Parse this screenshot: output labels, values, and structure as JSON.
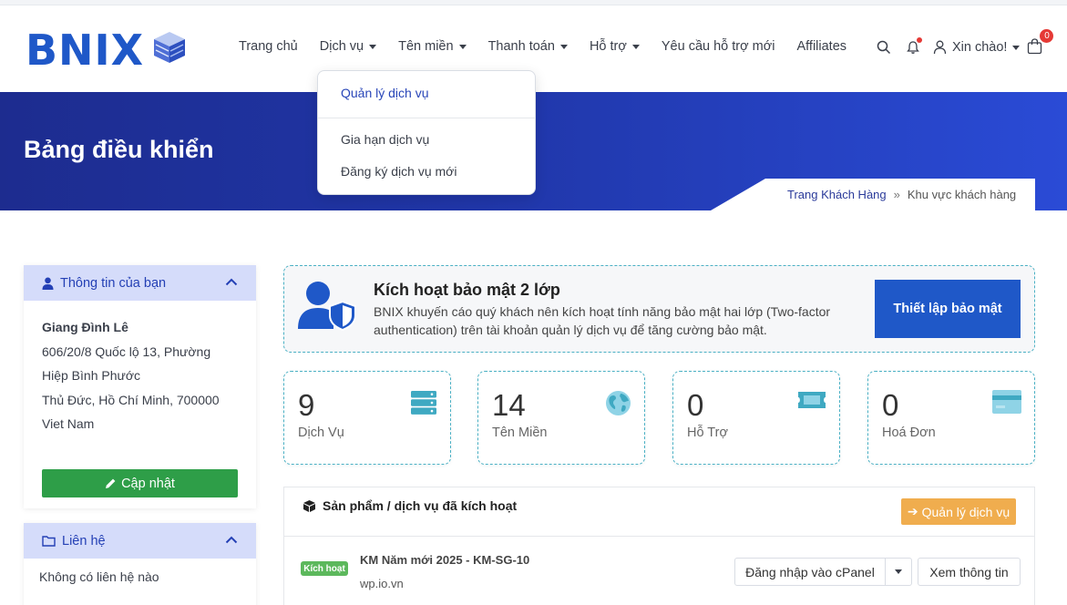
{
  "brand": {
    "logo_text": "BNIX",
    "accent": "#1f58c8"
  },
  "nav": {
    "items": [
      {
        "label": "Trang chủ",
        "caret": false
      },
      {
        "label": "Dịch vụ",
        "caret": true
      },
      {
        "label": "Tên miền",
        "caret": true
      },
      {
        "label": "Thanh toán",
        "caret": true
      },
      {
        "label": "Hỗ trợ",
        "caret": true
      },
      {
        "label": "Yêu cầu hỗ trợ mới",
        "caret": false
      },
      {
        "label": "Affiliates",
        "caret": false
      }
    ],
    "greeting": "Xin chào!",
    "cart_count": "0"
  },
  "dropdown": {
    "items": [
      "Quản lý dịch vụ",
      "Gia hạn dịch vụ",
      "Đăng ký dịch vụ mới"
    ]
  },
  "banner": {
    "title": "Bảng điều khiển",
    "breadcrumb_link": "Trang Khách Hàng",
    "breadcrumb_sep": "»",
    "breadcrumb_current": "Khu vực khách hàng"
  },
  "sidebar": {
    "info": {
      "title": "Thông tin của bạn",
      "name": "Giang Đình Lê",
      "address_lines": [
        "606/20/8 Quốc lộ 13, Phường",
        "Hiệp Bình Phước",
        "Thủ Đức, Hồ Chí Minh, 700000",
        "Viet Nam"
      ],
      "update_label": "Cập nhật"
    },
    "contact": {
      "title": "Liên hệ",
      "empty_text": "Không có liên hệ nào"
    }
  },
  "tfa": {
    "title": "Kích hoạt bảo mật 2 lớp",
    "description": "BNIX khuyến cáo quý khách nên kích hoạt tính năng bảo mật hai lớp (Two-factor authentication) trên tài khoản quản lý dịch vụ để tăng cường bảo mật.",
    "button": "Thiết lập bảo mật"
  },
  "stats": [
    {
      "value": "9",
      "label": "Dịch Vụ",
      "icon": "server-icon",
      "color": "#3fa9c2"
    },
    {
      "value": "14",
      "label": "Tên Miền",
      "icon": "globe-icon",
      "color": "#3fa9c2"
    },
    {
      "value": "0",
      "label": "Hỗ Trợ",
      "icon": "ticket-icon",
      "color": "#3fa9c2"
    },
    {
      "value": "0",
      "label": "Hoá Đơn",
      "icon": "credit-card-icon",
      "color": "#8fd3e6"
    }
  ],
  "products": {
    "title": "Sản phẩm / dịch vụ đã kích hoạt",
    "manage_label": "Quản lý dịch vụ",
    "rows": [
      {
        "status": "Kích hoạt",
        "name": "KM Năm mới 2025 - KM-SG-10",
        "domain": "wp.io.vn",
        "login_label": "Đăng nhập vào cPanel",
        "view_label": "Xem thông tin"
      }
    ]
  }
}
